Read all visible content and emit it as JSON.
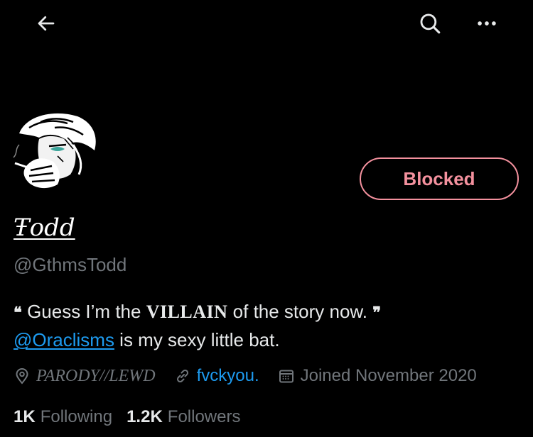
{
  "colors": {
    "background": "#000000",
    "text_primary": "#e7e9ea",
    "text_secondary": "#71767b",
    "link": "#1d9bf0",
    "blocked": "#f4919e"
  },
  "topbar": {
    "back_icon": "arrow-left-icon",
    "search_icon": "search-icon",
    "more_icon": "more-horizontal-icon"
  },
  "profile": {
    "display_name": "Ŧodd",
    "handle": "@GthmsTodd",
    "blocked_label": "Blocked"
  },
  "bio": {
    "open_quote": "❝",
    "text_before": " Guess I’m the ",
    "emphasis": "VILLAIN",
    "text_after": " of the story now. ",
    "close_quote": "❞",
    "mention": "@Oraclisms",
    "line2_rest": " is my sexy little bat."
  },
  "meta": {
    "location": "PARODY//LEWD",
    "website": "fvckyou.",
    "joined": "Joined November 2020"
  },
  "stats": {
    "following_count": "1K",
    "following_label": "Following",
    "followers_count": "1.2K",
    "followers_label": "Followers"
  }
}
